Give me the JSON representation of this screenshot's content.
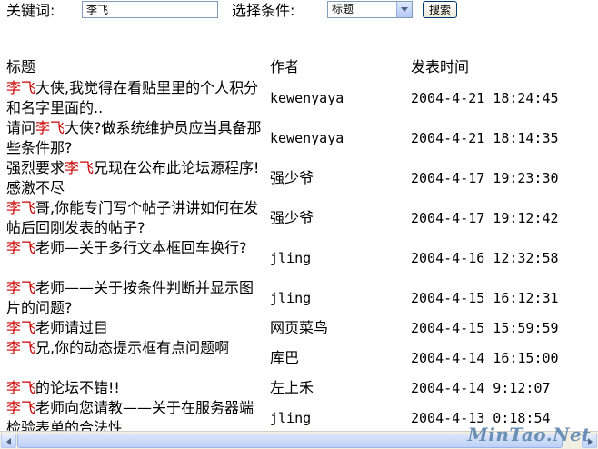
{
  "search": {
    "keyword_label": "关键词:",
    "keyword_value": "李飞",
    "condition_label": "选择条件:",
    "condition_selected": "标题",
    "search_button": "搜索"
  },
  "table": {
    "columns": [
      "标题",
      "作者",
      "发表时间"
    ],
    "rows": [
      {
        "highlight": "李飞",
        "title_before": "",
        "title_after": "大侠,我觉得在看贴里里的个人积分和名字里面的..",
        "author": "kewenyaya",
        "time": "2004-4-21 18:24:45"
      },
      {
        "highlight": "李飞",
        "title_before": "请问",
        "title_after": "大侠?做系统维护员应当具备那些条件那?",
        "author": "kewenyaya",
        "time": "2004-4-21 18:14:35"
      },
      {
        "highlight": "李飞",
        "title_before": "强烈要求",
        "title_after": "兄现在公布此论坛源程序!感激不尽",
        "author": "强少爷",
        "time": "2004-4-17 19:23:30"
      },
      {
        "highlight": "李飞",
        "title_before": "",
        "title_after": "哥,你能专门写个帖子讲讲如何在发帖后回刚发表的帖子?",
        "author": "强少爷",
        "time": "2004-4-17 19:12:42"
      },
      {
        "highlight": "李飞",
        "title_before": "",
        "title_after": "老师—关于多行文本框回车换行?",
        "author": "jling",
        "time": "2004-4-16 12:32:58"
      },
      {
        "highlight": "李飞",
        "title_before": "",
        "title_after": "老师——关于按条件判断并显示图片的问题?",
        "author": "jling",
        "time": "2004-4-15 16:12:31"
      },
      {
        "highlight": "李飞",
        "title_before": "",
        "title_after": "老师请过目",
        "author": "网页菜鸟",
        "time": "2004-4-15 15:59:59"
      },
      {
        "highlight": "李飞",
        "title_before": "",
        "title_after": "兄,你的动态提示框有点问题啊",
        "author": "库巴",
        "time": "2004-4-14 16:15:00"
      },
      {
        "highlight": "李飞",
        "title_before": "",
        "title_after": "的论坛不错!!",
        "author": "左上禾",
        "time": "2004-4-14 9:12:07"
      },
      {
        "highlight": "李飞",
        "title_before": "",
        "title_after": "老师向您请教——关于在服务器端检验表单的合法性",
        "author": "jling",
        "time": "2004-4-13 0:18:54"
      }
    ]
  },
  "watermark": "MinTao.Net",
  "colors": {
    "highlight": "#cc0000",
    "watermark": "#6a8fb5"
  }
}
